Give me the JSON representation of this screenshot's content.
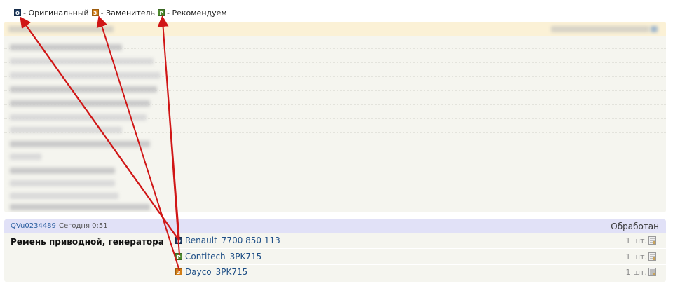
{
  "legend": [
    {
      "badge": "О",
      "label": "- Оригинальный",
      "kind": "original"
    },
    {
      "badge": "З",
      "label": "- Заменитель",
      "kind": "substitute"
    },
    {
      "badge": "Р",
      "label": "- Рекомендуем",
      "kind": "recommended"
    }
  ],
  "colors": {
    "original": "#1f3d63",
    "substitute": "#d27d16",
    "recommended": "#4e8a2f",
    "order_header_bg": "#e1e1f7",
    "panel_header_bg": "#fbf1d6",
    "arrow": "#d01616"
  },
  "order": {
    "id": "QVu0234489",
    "time": "Сегодня 0:51",
    "status": "Обработан",
    "product_name": "Ремень приводной, генератора",
    "parts": [
      {
        "badge": "О",
        "kind": "original",
        "brand": "Renault",
        "code": "7700 850 113",
        "qty": "1 шт."
      },
      {
        "badge": "Р",
        "kind": "recommended",
        "brand": "Contitech",
        "code": "3PK715",
        "qty": "1 шт."
      },
      {
        "badge": "З",
        "kind": "substitute",
        "brand": "Dayco",
        "code": "3PK715",
        "qty": "1 шт."
      }
    ]
  },
  "icons": {
    "cart": "cart-icon"
  }
}
